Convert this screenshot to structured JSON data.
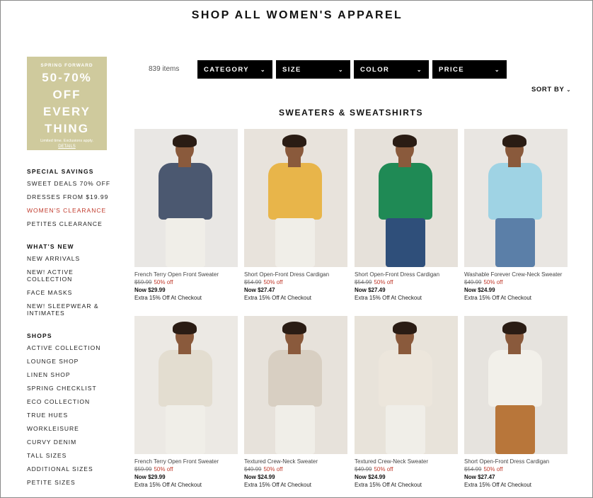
{
  "page_title": "SHOP ALL WOMEN'S APPAREL",
  "promo": {
    "pre": "SPRING FORWARD",
    "line1": "50-70%",
    "line2": "OFF",
    "line3": "EVERY",
    "line4": "THING",
    "fine": "Limited time. Exclusions apply.",
    "details": "DETAILS",
    "bg": "#cfca9d"
  },
  "sidebar": {
    "sections": [
      {
        "heading": "SPECIAL SAVINGS",
        "links": [
          "SWEET DEALS 70% OFF",
          "DRESSES FROM $19.99",
          "WOMEN'S CLEARANCE",
          "PETITES CLEARANCE"
        ]
      },
      {
        "heading": "WHAT'S NEW",
        "links": [
          "NEW ARRIVALS",
          "NEW! ACTIVE COLLECTION",
          "FACE MASKS",
          "NEW! SLEEPWEAR & INTIMATES"
        ]
      },
      {
        "heading": "SHOPS",
        "links": [
          "ACTIVE COLLECTION",
          "LOUNGE SHOP",
          "LINEN SHOP",
          "SPRING CHECKLIST",
          "ECO COLLECTION",
          "TRUE HUES",
          "WORKLEISURE",
          "CURVY DENIM",
          "TALL SIZES",
          "ADDITIONAL SIZES",
          "PETITE SIZES"
        ]
      }
    ],
    "active_link": "WOMEN'S CLEARANCE",
    "active_color": "#c0392b"
  },
  "toolbar": {
    "item_count": "839 items",
    "filters": [
      "CATEGORY",
      "SIZE",
      "COLOR",
      "PRICE"
    ],
    "sort_label": "SORT BY"
  },
  "section_title": "SWEATERS & SWEATSHIRTS",
  "products": [
    {
      "name": "French Terry Open Front Sweater",
      "orig": "$59.99",
      "pct": "50% off",
      "now": "Now $29.99",
      "extra": "Extra 15% Off At Checkout",
      "garment": "#4b5870",
      "bg": "#e9e7e4"
    },
    {
      "name": "Short Open-Front Dress Cardigan",
      "orig": "$54.99",
      "pct": "50% off",
      "now": "Now $27.47",
      "extra": "Extra 15% Off At Checkout",
      "garment": "#e8b54a",
      "bg": "#e8e3dc"
    },
    {
      "name": "Short Open-Front Dress Cardigan",
      "orig": "$54.99",
      "pct": "50% off",
      "now": "Now $27.49",
      "extra": "Extra 15% Off At Checkout",
      "garment": "#1f8a55",
      "bg": "#e6e1da"
    },
    {
      "name": "Washable Forever Crew-Neck Sweater",
      "orig": "$49.99",
      "pct": "50% off",
      "now": "Now $24.99",
      "extra": "Extra 15% Off At Checkout",
      "garment": "#9fd3e4",
      "bg": "#e9e6e2"
    },
    {
      "name": "French Terry Open Front Sweater",
      "orig": "$59.99",
      "pct": "50% off",
      "now": "Now $29.99",
      "extra": "Extra 15% Off At Checkout",
      "garment": "#e3ddd0",
      "bg": "#ece9e4"
    },
    {
      "name": "Textured Crew-Neck Sweater",
      "orig": "$49.99",
      "pct": "50% off",
      "now": "Now $24.99",
      "extra": "Extra 15% Off At Checkout",
      "garment": "#d8cfc2",
      "bg": "#e7e2db"
    },
    {
      "name": "Textured Crew-Neck Sweater",
      "orig": "$49.99",
      "pct": "50% off",
      "now": "Now $24.99",
      "extra": "Extra 15% Off At Checkout",
      "garment": "#ece6dc",
      "bg": "#e8e3da"
    },
    {
      "name": "Short Open-Front Dress Cardigan",
      "orig": "$54.99",
      "pct": "50% off",
      "now": "Now $27.47",
      "extra": "Extra 15% Off At Checkout",
      "garment": "#f2f0ea",
      "bg": "#e6e3de"
    }
  ]
}
